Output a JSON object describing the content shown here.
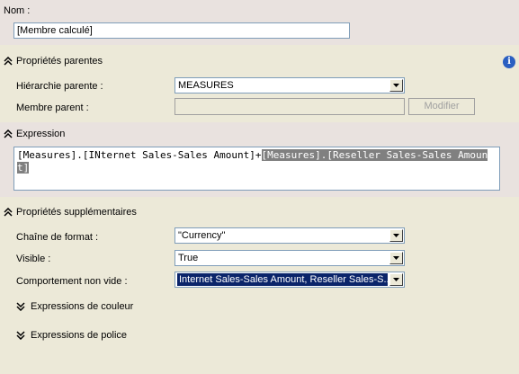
{
  "name": {
    "label": "Nom :",
    "value": "[Membre calculé]"
  },
  "parent_properties": {
    "header": "Propriétés parentes",
    "hierarchy_label": "Hiérarchie parente :",
    "hierarchy_value": "MEASURES",
    "parent_member_label": "Membre parent :",
    "parent_member_value": "",
    "modify_button": "Modifier"
  },
  "expression": {
    "header": "Expression",
    "part1": "[Measures].[INternet Sales-Sales Amount]+",
    "part2_selected": "[Measures].[Reseller Sales-Sales Amount]"
  },
  "additional_properties": {
    "header": "Propriétés supplémentaires",
    "format_label": "Chaîne de format :",
    "format_value": "\"Currency\"",
    "visible_label": "Visible :",
    "visible_value": "True",
    "non_empty_label": "Comportement non vide :",
    "non_empty_value": "Internet Sales-Sales Amount, Reseller Sales-S...",
    "color_expressions": "Expressions de couleur",
    "font_expressions": "Expressions de police"
  },
  "colors": {
    "pink_band": "#e9e2df",
    "gray_band": "#ece9d8",
    "selection": "#0a246a",
    "info_icon": "#2a5fc1"
  }
}
